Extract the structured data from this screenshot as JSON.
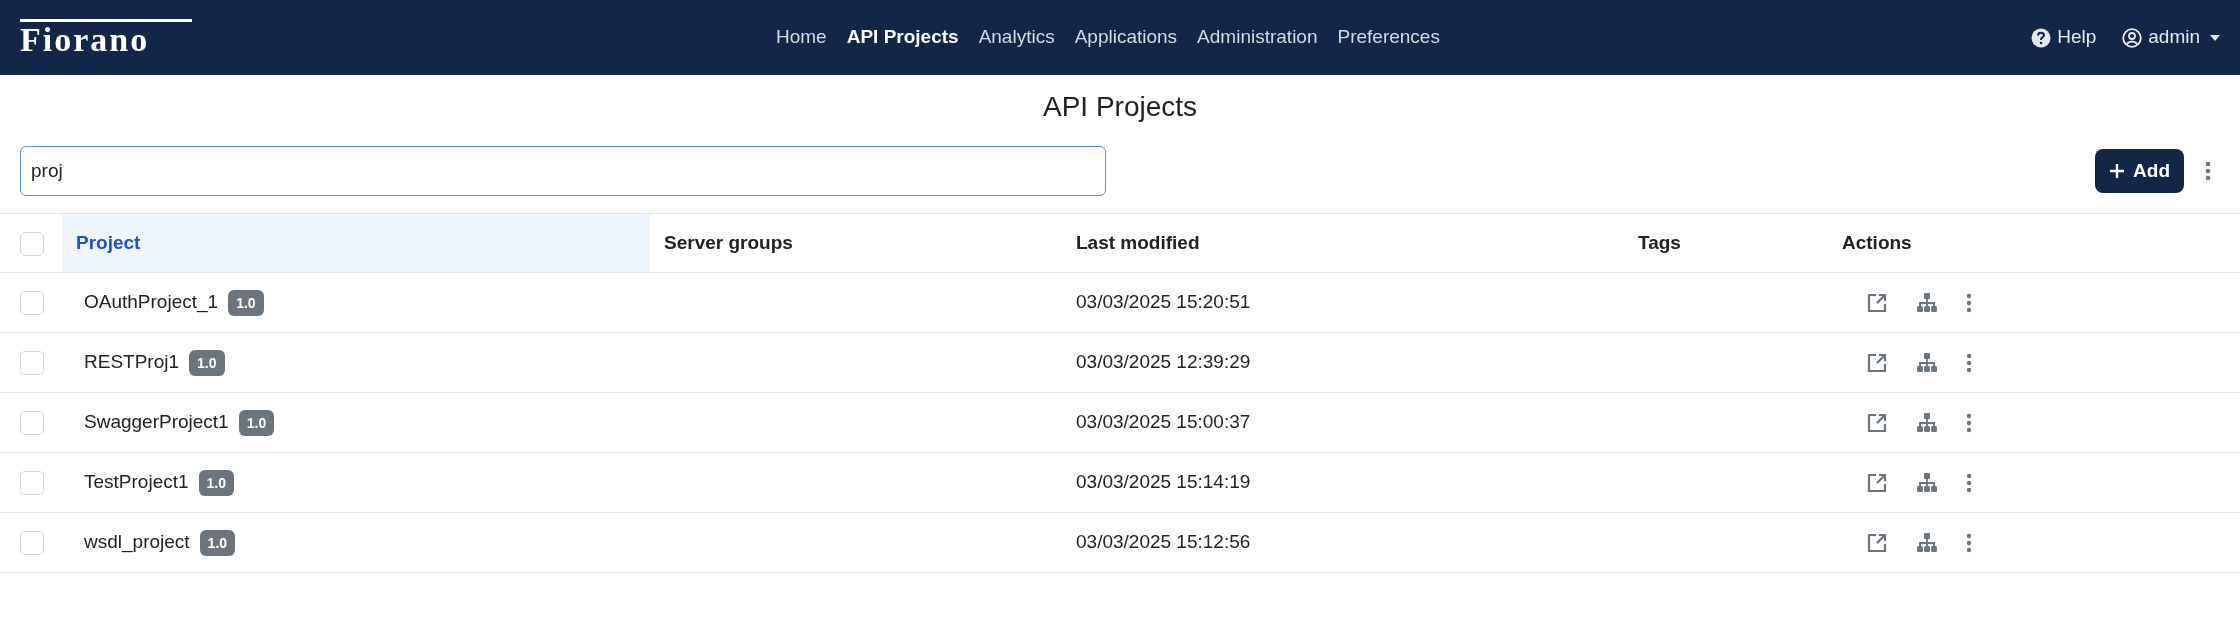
{
  "navbar": {
    "logo": "Fiorano",
    "links": [
      {
        "label": "Home",
        "selected": false
      },
      {
        "label": "API Projects",
        "selected": true
      },
      {
        "label": "Analytics",
        "selected": false
      },
      {
        "label": "Applications",
        "selected": false
      },
      {
        "label": "Administration",
        "selected": false
      },
      {
        "label": "Preferences",
        "selected": false
      }
    ],
    "help": "Help",
    "user": "admin"
  },
  "page_title": "API Projects",
  "search": {
    "value": "proj"
  },
  "add_button": "Add",
  "table": {
    "columns": [
      {
        "label": "Project",
        "sorted": true
      },
      {
        "label": "Server groups",
        "sorted": false
      },
      {
        "label": "Last modified",
        "sorted": false
      },
      {
        "label": "Tags",
        "sorted": false
      },
      {
        "label": "Actions",
        "sorted": false
      }
    ],
    "select_all": false,
    "rows": [
      {
        "checked": false,
        "project": "OAuthProject_1",
        "version": "1.0",
        "last_modified": "03/03/2025 15:20:51"
      },
      {
        "checked": false,
        "project": "RESTProj1",
        "version": "1.0",
        "last_modified": "03/03/2025 12:39:29"
      },
      {
        "checked": false,
        "project": "SwaggerProject1",
        "version": "1.0",
        "last_modified": "03/03/2025 15:00:37"
      },
      {
        "checked": false,
        "project": "TestProject1",
        "version": "1.0",
        "last_modified": "03/03/2025 15:14:19"
      },
      {
        "checked": false,
        "project": "wsdl_project",
        "version": "1.0",
        "last_modified": "03/03/2025 15:12:56"
      }
    ]
  }
}
